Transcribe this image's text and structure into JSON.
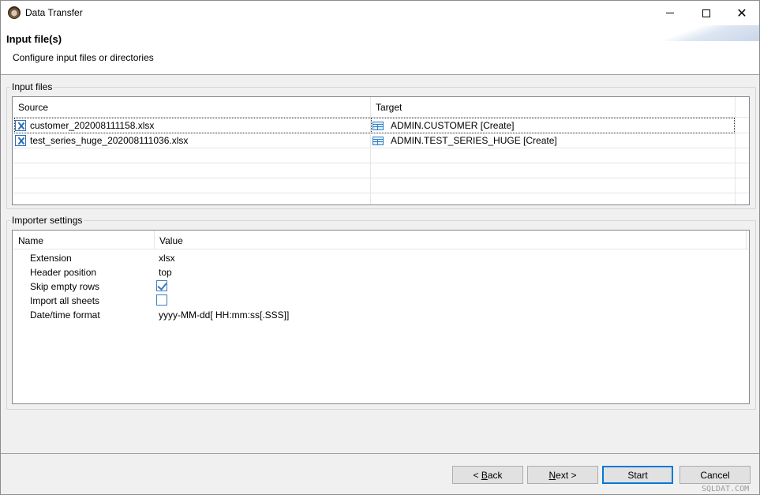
{
  "window": {
    "title": "Data Transfer",
    "minimize_label": "–",
    "maximize_label": "□",
    "close_label": "✕"
  },
  "header": {
    "title": "Input file(s)",
    "description": "Configure input files or directories"
  },
  "input_files": {
    "group_label": "Input files",
    "columns": [
      "Source",
      "Target"
    ],
    "rows": [
      {
        "source": "customer_202008111158.xlsx",
        "target": "ADMIN.CUSTOMER [Create]",
        "selected": true
      },
      {
        "source": "test_series_huge_202008111036.xlsx",
        "target": "ADMIN.TEST_SERIES_HUGE [Create]",
        "selected": false
      }
    ]
  },
  "importer_settings": {
    "group_label": "Importer settings",
    "columns": [
      "Name",
      "Value"
    ],
    "rows": [
      {
        "name": "Extension",
        "value": "xlsx"
      },
      {
        "name": "Header position",
        "value": "top"
      },
      {
        "name": "Skip empty rows",
        "value": true
      },
      {
        "name": "Import all sheets",
        "value": false
      },
      {
        "name": "Date/time format",
        "value": "yyyy-MM-dd[ HH:mm:ss[.SSS]]"
      }
    ]
  },
  "buttons": {
    "back_prefix": "< ",
    "back_mnemonic": "B",
    "back_rest": "ack",
    "next_mnemonic": "N",
    "next_rest": "ext >",
    "start": "Start",
    "cancel": "Cancel"
  },
  "watermark": "SQLDAT.COM"
}
